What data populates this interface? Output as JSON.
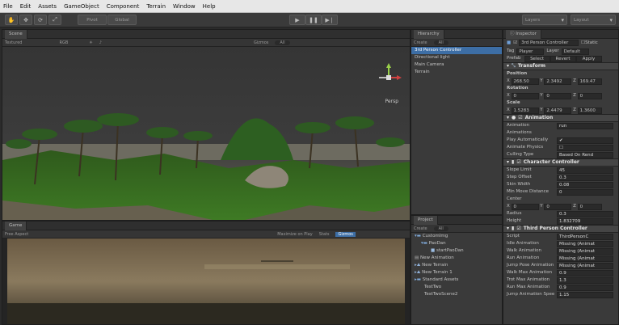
{
  "menu": [
    "File",
    "Edit",
    "Assets",
    "GameObject",
    "Component",
    "Terrain",
    "Window",
    "Help"
  ],
  "toolbar": {
    "tools": [
      "hand-icon",
      "move-icon",
      "rotate-icon",
      "scale-icon"
    ],
    "pivot": "Pivot",
    "global": "Global",
    "play_icons": [
      "play-icon",
      "pause-icon",
      "step-icon"
    ],
    "layers": "Layers",
    "layout": "Layout"
  },
  "scene": {
    "tab": "Scene",
    "shading": "Textured",
    "render_mode": "RGB",
    "gizmos": "Gizmos",
    "search": "All",
    "persp": "Persp"
  },
  "game": {
    "tab": "Game",
    "aspect": "Free Aspect",
    "toggles": [
      "Maximize on Play",
      "Stats",
      "Gizmos"
    ]
  },
  "hierarchy": {
    "tab": "Hierarchy",
    "create": "Create",
    "search": "All",
    "items": [
      "3rd Person Controller",
      "Directional light",
      "Main Camera",
      "Terrain"
    ],
    "selected_index": 0
  },
  "project": {
    "tab": "Project",
    "create": "Create",
    "search": "All",
    "items": [
      "CustomImg",
      "PaoDan",
      "startPaoDan",
      "New Animation",
      "New Terrain",
      "New Terrain 1",
      "Standard Assets",
      "TestTwo",
      "TestTwoScene2"
    ]
  },
  "inspector": {
    "tab": "Inspector",
    "object_name": "3rd Person Controller",
    "static": "Static",
    "tag_label": "Tag",
    "tag": "Player",
    "layer_label": "Layer",
    "layer": "Default",
    "prefab_label": "Prefab",
    "prefab_buttons": [
      "Select",
      "Revert",
      "Apply"
    ],
    "transform": {
      "title": "Transform",
      "position_label": "Position",
      "position": {
        "x": "268.50",
        "y": "2.3492",
        "z": "169.47"
      },
      "rotation_label": "Rotation",
      "rotation": {
        "x": "0",
        "y": "0",
        "z": "0"
      },
      "scale_label": "Scale",
      "scale": {
        "x": "1.5283",
        "y": "2.4479",
        "z": "1.3600"
      }
    },
    "animation": {
      "title": "Animation",
      "rows": [
        {
          "label": "Animation",
          "value": "run"
        },
        {
          "label": "Animations",
          "value": ""
        },
        {
          "label": "Play Automatically",
          "value": "✔"
        },
        {
          "label": "Animate Physics",
          "value": "☐"
        },
        {
          "label": "Culling Type",
          "value": "Based On Rend"
        }
      ]
    },
    "character_controller": {
      "title": "Character Controller",
      "rows": [
        {
          "label": "Slope Limit",
          "value": "45"
        },
        {
          "label": "Step Offset",
          "value": "0.3"
        },
        {
          "label": "Skin Width",
          "value": "0.08"
        },
        {
          "label": "Min Move Distance",
          "value": "0"
        },
        {
          "label": "Center",
          "value": ""
        }
      ],
      "center": {
        "x": "0",
        "y": "0",
        "z": "0"
      },
      "rows2": [
        {
          "label": "Radius",
          "value": "0.3"
        },
        {
          "label": "Height",
          "value": "1.832709"
        }
      ]
    },
    "third_person": {
      "title": "Third Person Controller",
      "rows": [
        {
          "label": "Script",
          "value": "ThirdPersonC"
        },
        {
          "label": "Idle Animation",
          "value": "Missing (Animat"
        },
        {
          "label": "Walk Animation",
          "value": "Missing (Animat"
        },
        {
          "label": "Run Animation",
          "value": "Missing (Animat"
        },
        {
          "label": "Jump Pose Animation",
          "value": "Missing (Animat"
        },
        {
          "label": "Walk Max Animation",
          "value": "0.9"
        },
        {
          "label": "Trot Max Animation",
          "value": "1.3"
        },
        {
          "label": "Run Max Animation",
          "value": "0.9"
        },
        {
          "label": "Jump Animation Spee",
          "value": "1.15"
        }
      ]
    }
  }
}
